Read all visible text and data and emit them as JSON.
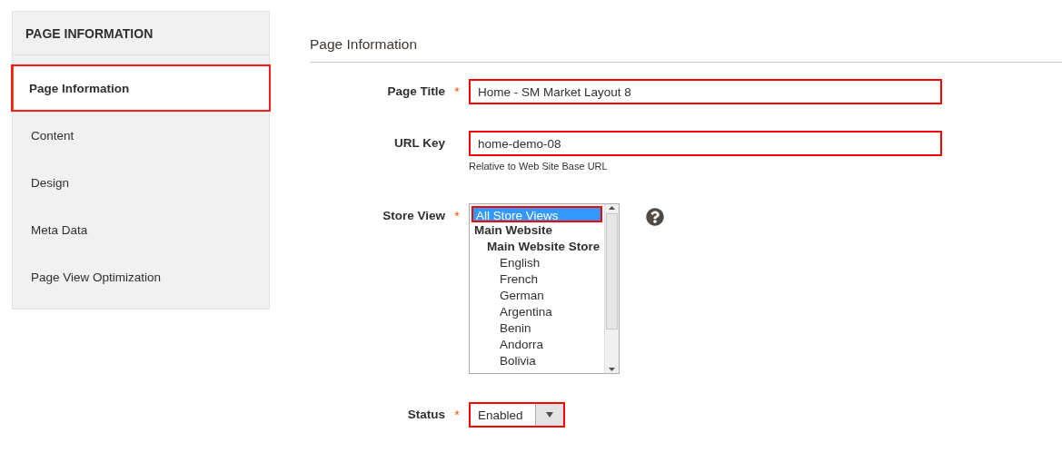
{
  "sidebar": {
    "title": "PAGE INFORMATION",
    "items": [
      {
        "label": "Page Information",
        "selected": true,
        "highlighted": true
      },
      {
        "label": "Content",
        "selected": false,
        "highlighted": false
      },
      {
        "label": "Design",
        "selected": false,
        "highlighted": false
      },
      {
        "label": "Meta Data",
        "selected": false,
        "highlighted": false
      },
      {
        "label": "Page View Optimization",
        "selected": false,
        "highlighted": false
      }
    ]
  },
  "section": {
    "title": "Page Information",
    "fields": [
      {
        "kind": "text",
        "label": "Page Title",
        "required_mark": "*",
        "value": "Home - SM Market Layout 8",
        "highlighted": true
      },
      {
        "kind": "text",
        "label": "URL Key",
        "value": "home-demo-08",
        "note": "Relative to Web Site Base URL",
        "highlighted": true
      },
      {
        "kind": "multiselect",
        "label": "Store View",
        "required_mark": "*",
        "options": [
          {
            "label": "All Store Views",
            "selected": true,
            "highlighted": true
          },
          {
            "label": "Main Website",
            "selected": false,
            "highlighted": false,
            "children": [
              {
                "label": "Main Website Store",
                "selected": false,
                "highlighted": false,
                "children": [
                  {
                    "label": "English",
                    "selected": false,
                    "highlighted": false
                  },
                  {
                    "label": "French",
                    "selected": false,
                    "highlighted": false
                  },
                  {
                    "label": "German",
                    "selected": false,
                    "highlighted": false
                  },
                  {
                    "label": "Argentina",
                    "selected": false,
                    "highlighted": false
                  },
                  {
                    "label": "Benin",
                    "selected": false,
                    "highlighted": false
                  },
                  {
                    "label": "Andorra",
                    "selected": false,
                    "highlighted": false
                  },
                  {
                    "label": "Bolivia",
                    "selected": false,
                    "highlighted": false
                  }
                ]
              }
            ]
          }
        ]
      },
      {
        "kind": "select",
        "label": "Status",
        "required_mark": "*",
        "value": "Enabled",
        "highlighted": true
      }
    ]
  }
}
